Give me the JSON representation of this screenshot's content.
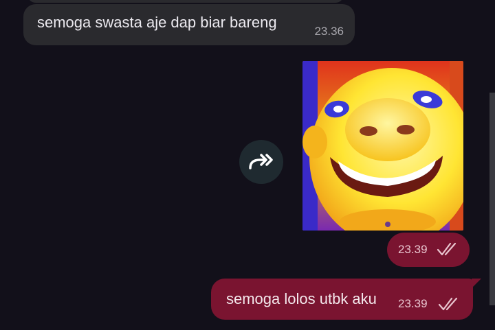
{
  "messages": {
    "incoming": {
      "text": "semoga swasta aje dap biar bareng",
      "time": "23.36"
    },
    "sticker": {
      "time": "23.39",
      "status_icon": "double-check-icon"
    },
    "outgoing": {
      "text": "semoga lolos utbk aku",
      "time": "23.39",
      "status_icon": "double-check-icon"
    }
  },
  "forward_button": {
    "icon": "forward-arrow-icon"
  },
  "colors": {
    "background": "#12101a",
    "incoming_bubble": "#2a2a2e",
    "outgoing_bubble": "#7a1430",
    "forward_button": "#1f2a30"
  }
}
